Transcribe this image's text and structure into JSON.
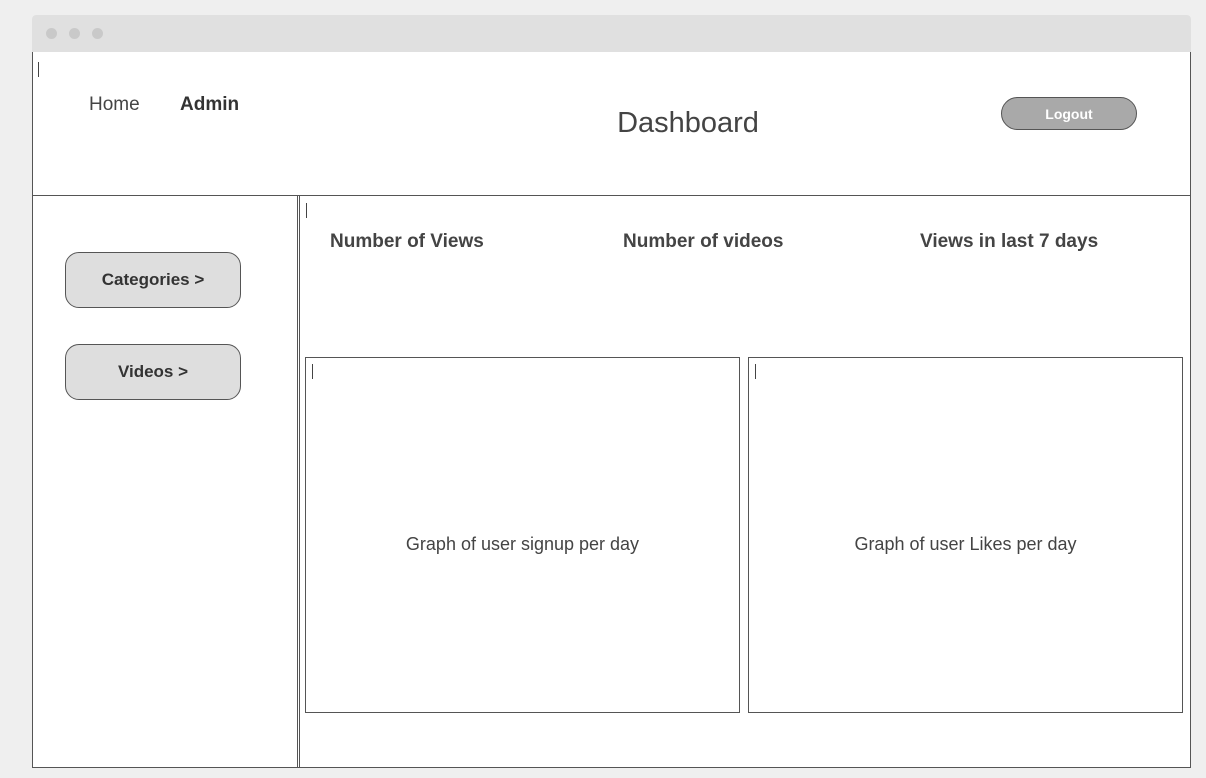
{
  "window": {
    "controls": [
      "close",
      "minimize",
      "maximize"
    ]
  },
  "header": {
    "nav": {
      "home": "Home",
      "admin": "Admin"
    },
    "title": "Dashboard",
    "logout_label": "Logout"
  },
  "sidebar": {
    "items": [
      {
        "label": "Categories >"
      },
      {
        "label": "Videos >"
      }
    ]
  },
  "main": {
    "stats": [
      {
        "label": "Number of Views"
      },
      {
        "label": "Number of videos"
      },
      {
        "label": "Views in last 7 days"
      }
    ],
    "graphs": [
      {
        "label": "Graph of user signup per day"
      },
      {
        "label": "Graph of user Likes per day"
      }
    ]
  },
  "colors": {
    "button_fill": "#dedede",
    "logout_fill": "#a9a9a9",
    "border": "#555555",
    "titlebar": "#e0e0e0"
  }
}
